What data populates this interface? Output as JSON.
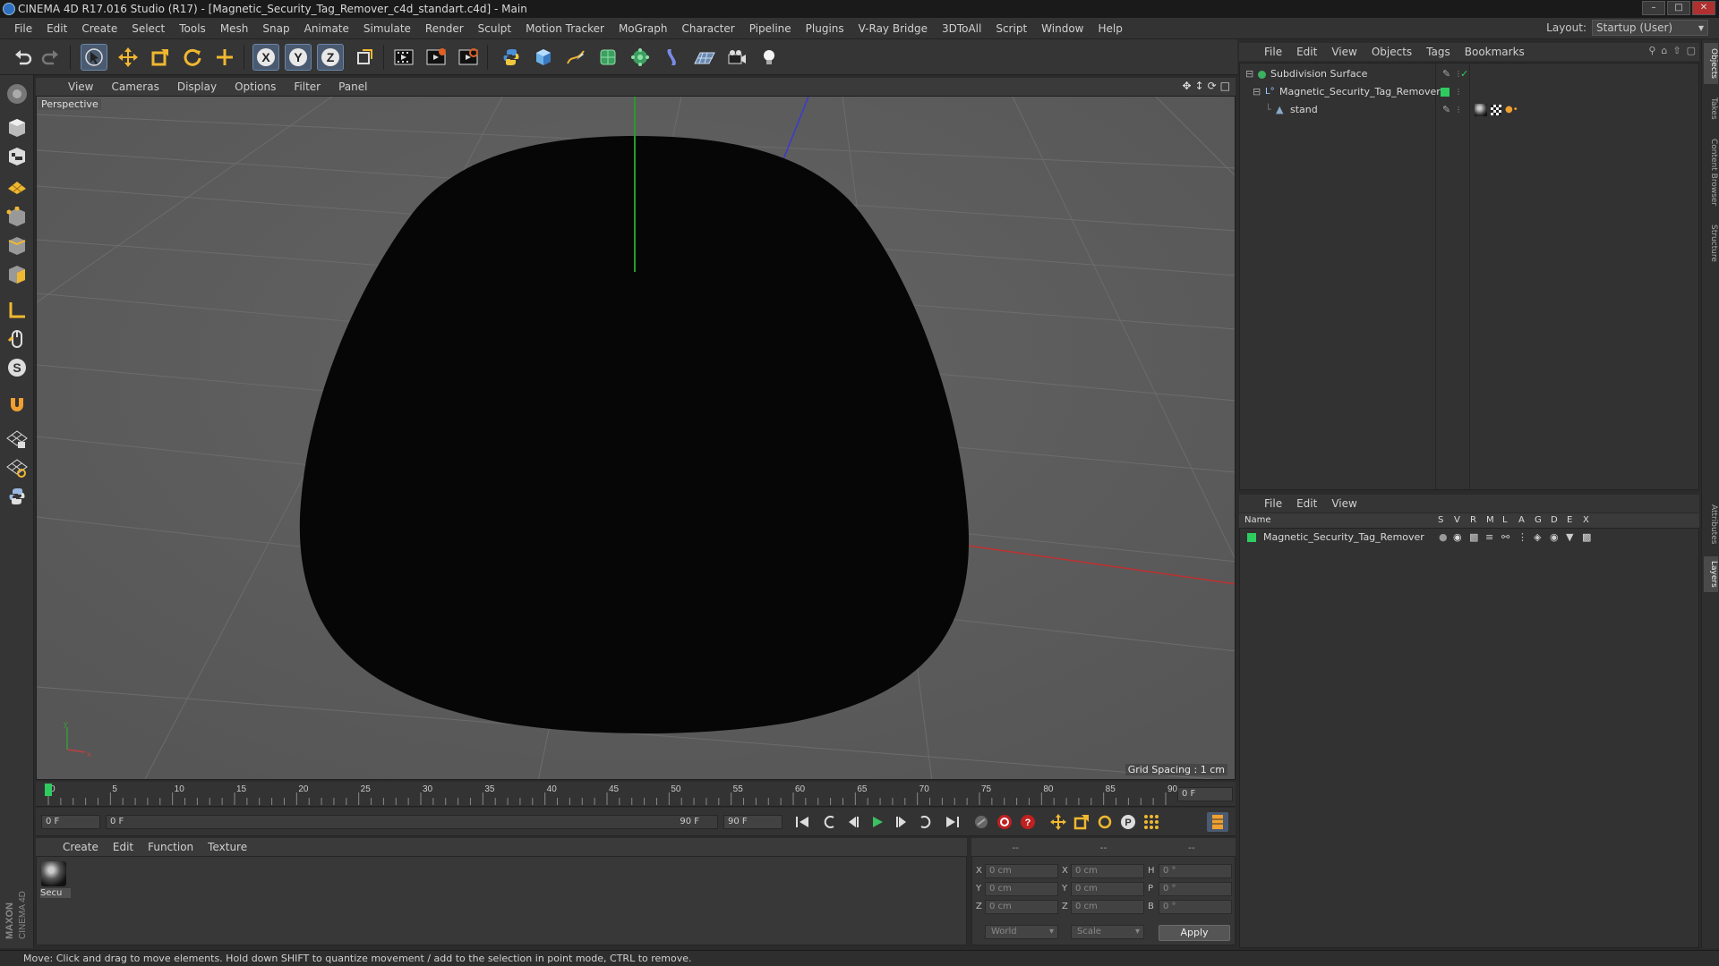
{
  "window": {
    "title": "CINEMA 4D R17.016 Studio (R17) - [Magnetic_Security_Tag_Remover_c4d_standart.c4d] - Main",
    "controls": [
      "minimize",
      "maximize",
      "close"
    ]
  },
  "menubar": {
    "items": [
      "File",
      "Edit",
      "Create",
      "Select",
      "Tools",
      "Mesh",
      "Snap",
      "Animate",
      "Simulate",
      "Render",
      "Sculpt",
      "Motion Tracker",
      "MoGraph",
      "Character",
      "Pipeline",
      "Plugins",
      "V-Ray Bridge",
      "3DToAll",
      "Script",
      "Window",
      "Help"
    ],
    "layout_label": "Layout:",
    "layout_value": "Startup (User)"
  },
  "toolbar": {
    "icons": [
      "undo-icon",
      "redo-icon",
      "select-icon",
      "move-icon",
      "scale-icon",
      "rotate-icon",
      "add-object-icon",
      "x-axis-icon",
      "y-axis-icon",
      "z-axis-icon",
      "coordinate-system-icon",
      "render-view-icon",
      "render-picture-viewer-icon",
      "render-settings-icon",
      "python-icon",
      "cube-icon",
      "spline-pen-icon",
      "subdivision-icon",
      "array-icon",
      "deformer-icon",
      "floor-icon",
      "camera-icon",
      "light-icon"
    ]
  },
  "viewport": {
    "menu": [
      "View",
      "Cameras",
      "Display",
      "Options",
      "Filter",
      "Panel"
    ],
    "label": "Perspective",
    "grid_spacing": "Grid Spacing : 1 cm",
    "bg_color": "#5c5c5c",
    "object_color": "#060606"
  },
  "timeline": {
    "ticks": [
      "0",
      "5",
      "10",
      "15",
      "20",
      "25",
      "30",
      "35",
      "40",
      "45",
      "50",
      "55",
      "60",
      "65",
      "70",
      "75",
      "80",
      "85",
      "90"
    ],
    "current_frame": "0 F",
    "start_field": "0 F",
    "range_start": "0 F",
    "range_end": "90 F",
    "end_field": "90 F"
  },
  "material_manager": {
    "menu": [
      "Create",
      "Edit",
      "Function",
      "Texture"
    ],
    "material_name": "Secu"
  },
  "coordinates": {
    "headers": [
      "--",
      "--",
      "--"
    ],
    "rows": [
      {
        "l1": "X",
        "v1": "0 cm",
        "l2": "X",
        "v2": "0 cm",
        "l3": "H",
        "v3": "0 °"
      },
      {
        "l1": "Y",
        "v1": "0 cm",
        "l2": "Y",
        "v2": "0 cm",
        "l3": "P",
        "v3": "0 °"
      },
      {
        "l1": "Z",
        "v1": "0 cm",
        "l2": "Z",
        "v2": "0 cm",
        "l3": "B",
        "v3": "0 °"
      }
    ],
    "space": "World",
    "mode": "Scale",
    "apply_label": "Apply"
  },
  "object_manager": {
    "menu": [
      "File",
      "Edit",
      "View",
      "Objects",
      "Tags",
      "Bookmarks"
    ],
    "objects": [
      {
        "name": "Subdivision Surface"
      },
      {
        "name": "Magnetic_Security_Tag_Remover"
      },
      {
        "name": "stand"
      }
    ]
  },
  "layer_manager": {
    "menu": [
      "File",
      "Edit",
      "View"
    ],
    "columns": [
      "Name",
      "S",
      "V",
      "R",
      "M",
      "L",
      "A",
      "G",
      "D",
      "E",
      "X"
    ],
    "layers": [
      {
        "name": "Magnetic_Security_Tag_Remover",
        "color": "#2ecc60"
      }
    ]
  },
  "right_tabs": [
    "Objects",
    "Takes",
    "Content Browser",
    "Structure",
    "Attributes",
    "Layers"
  ],
  "branding": {
    "maxon": "MAXON",
    "product": "CINEMA 4D"
  },
  "statusbar": {
    "text": "Move: Click and drag to move elements. Hold down SHIFT to quantize movement / add to the selection in point mode, CTRL to remove."
  }
}
